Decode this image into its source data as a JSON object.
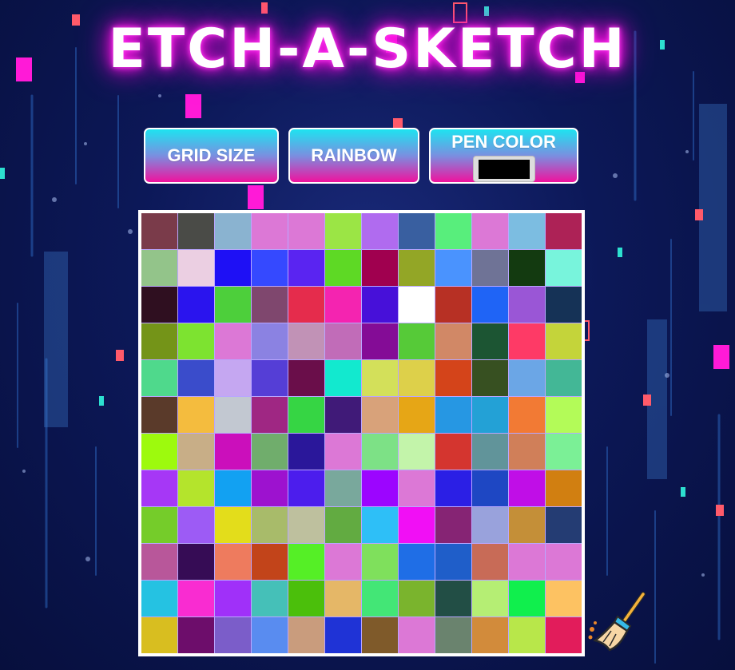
{
  "title": "ETCH-A-SKETCH",
  "buttons": {
    "grid_size": "GRID SIZE",
    "rainbow": "RAINBOW",
    "pen_color": "PEN COLOR"
  },
  "pen_color_value": "#000000",
  "colors": {
    "background": "#0c1858",
    "title_glow": "#ff1ee8",
    "button_top": "#1ee3f0",
    "button_bottom": "#f0129e",
    "grid_line": "#b9a6ff"
  },
  "grid": {
    "size": 12,
    "cells": [
      [
        "#7a3b4a",
        "#4a4b47",
        "#8ab3d0",
        "#dc78d6",
        "#dc78d6",
        "#9be545",
        "#b06bef",
        "#395fa0",
        "#58ee7c",
        "#dc78d6",
        "#7cbde1",
        "#ad2256"
      ],
      [
        "#93c48a",
        "#ebcfe2",
        "#1e10f5",
        "#3549ff",
        "#5a24f1",
        "#5ed925",
        "#a0004f",
        "#93a626",
        "#4a93fe",
        "#6f7396",
        "#133a10",
        "#78f4dc"
      ],
      [
        "#2f0f20",
        "#2a14ee",
        "#4dcf3b",
        "#7f476e",
        "#e52c4c",
        "#f424b0",
        "#4710d9",
        "#ffffff",
        "#b73024",
        "#1f64f6",
        "#9a56d6",
        "#153256"
      ],
      [
        "#749418",
        "#7de330",
        "#dc78d6",
        "#8b82e2",
        "#c192b6",
        "#c16cb8",
        "#840c96",
        "#56ca38",
        "#d18866",
        "#1c5533",
        "#fe3a66",
        "#c4d43a"
      ],
      [
        "#4fd98c",
        "#3a4ccb",
        "#c5a7f1",
        "#553ed6",
        "#6a0e4a",
        "#12e9cf",
        "#d3e05a",
        "#ddd04a",
        "#d4441a",
        "#375021",
        "#6ba6e6",
        "#43b796"
      ],
      [
        "#5a3a2a",
        "#f4bc3e",
        "#c2c8d1",
        "#9f2783",
        "#36d544",
        "#401a78",
        "#d8a27a",
        "#e6a616",
        "#2697e3",
        "#23a1d6",
        "#f27a34",
        "#b3fb58"
      ],
      [
        "#9dfa0d",
        "#c8ae87",
        "#cb0fbb",
        "#70ad6c",
        "#2a179a",
        "#dc78d6",
        "#7de186",
        "#c3f4aa",
        "#d4352f",
        "#61949a",
        "#d07f59",
        "#7bf096"
      ],
      [
        "#a637f6",
        "#b4e42c",
        "#12a1f2",
        "#9d12cf",
        "#4c1ded",
        "#79a89c",
        "#9c05ff",
        "#dc78d6",
        "#2b1fe5",
        "#1e47c3",
        "#c00ee7",
        "#d17f11"
      ],
      [
        "#75cc2a",
        "#9d5bf5",
        "#e3dd1b",
        "#a8bb6a",
        "#bec09e",
        "#62ab41",
        "#2ebff7",
        "#f10ff5",
        "#862474",
        "#99a2dc",
        "#c48f38",
        "#243c73"
      ],
      [
        "#b8579a",
        "#360c55",
        "#ee7b5e",
        "#c2441a",
        "#55ef26",
        "#dc78d6",
        "#7fe05c",
        "#1f6ee6",
        "#1f5ec9",
        "#c86b57",
        "#dc78d6",
        "#dc78d6"
      ],
      [
        "#25c2e2",
        "#f92cd1",
        "#a030f9",
        "#45c0b8",
        "#4bbf0b",
        "#e5b767",
        "#43e676",
        "#7ab42d",
        "#224e45",
        "#b5ee74",
        "#10ef4d",
        "#fdc262"
      ],
      [
        "#d8be20",
        "#6d0d6b",
        "#7b5dc9",
        "#598cf0",
        "#c99c7d",
        "#1f33d6",
        "#7f5a2a",
        "#dc78d6",
        "#6a836e",
        "#d28b3b",
        "#b8e74a",
        "#e21c5b"
      ]
    ]
  }
}
